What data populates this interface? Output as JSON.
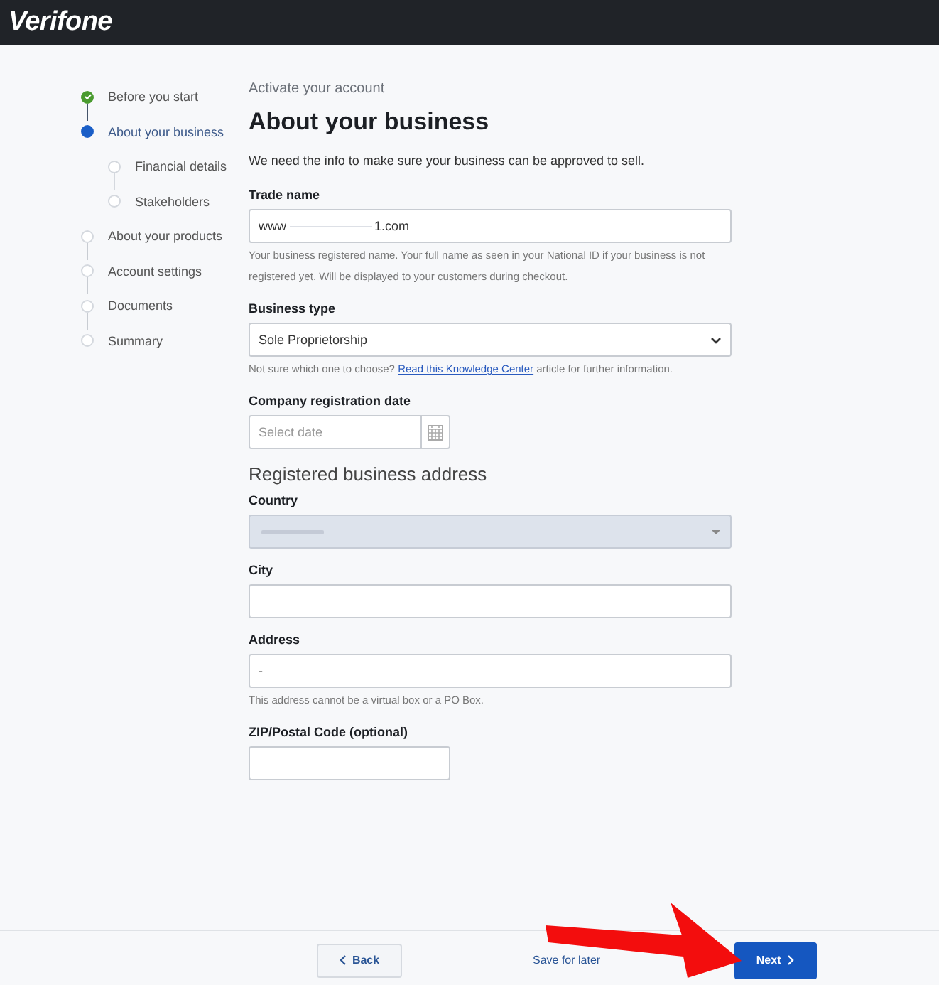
{
  "header": {
    "logo": "Verifone"
  },
  "steps": [
    {
      "label": "Before you start",
      "done": true,
      "current": false
    },
    {
      "label": "About your business",
      "done": false,
      "current": true,
      "children": [
        {
          "label": "Financial details",
          "done": false,
          "current": false
        },
        {
          "label": "Stakeholders",
          "done": false,
          "current": false
        }
      ]
    },
    {
      "label": "About your products",
      "done": false,
      "current": false
    },
    {
      "label": "Account settings",
      "done": false,
      "current": false
    },
    {
      "label": "Documents",
      "done": false,
      "current": false
    },
    {
      "label": "Summary",
      "done": false,
      "current": false
    }
  ],
  "form": {
    "eyebrow": "Activate your account",
    "title": "About your business",
    "intro": "We need the info to make sure your business can be approved to sell.",
    "fields": [
      {
        "kind": "text",
        "label": "Trade name",
        "value": "www",
        "value_end": "1.com",
        "redacted": true,
        "help": "Your business registered name. Your full name as seen in your National ID if your business is not registered yet. Will be displayed to your customers during checkout."
      },
      {
        "kind": "select",
        "label": "Business type",
        "value": "Sole Proprietorship",
        "help_start": "Not sure which one to choose? ",
        "help_link": "Read this Knowledge Center",
        "help_end": " article for further information."
      },
      {
        "kind": "date",
        "label": "Company registration date",
        "placeholder": "Select date"
      },
      {
        "kind": "heading",
        "label": "Registered business address"
      },
      {
        "kind": "select",
        "label": "Country",
        "redacted": true,
        "disabled": true
      },
      {
        "kind": "text",
        "label": "City"
      },
      {
        "kind": "text",
        "label": "Address",
        "value": "-",
        "help": "This address cannot be a virtual box or a PO Box."
      },
      {
        "kind": "short",
        "label": "ZIP/Postal Code (optional)"
      }
    ]
  },
  "footer": {
    "back": "Back",
    "save": "Save for later",
    "next": "Next"
  }
}
